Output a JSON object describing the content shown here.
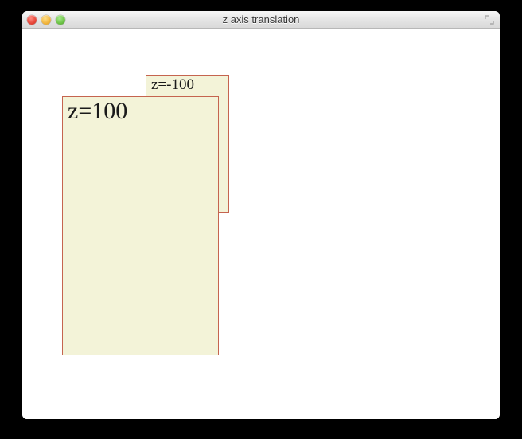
{
  "window": {
    "title": "z axis translation"
  },
  "boxes": {
    "back_label": "z=-100",
    "front_label": "z=100"
  }
}
